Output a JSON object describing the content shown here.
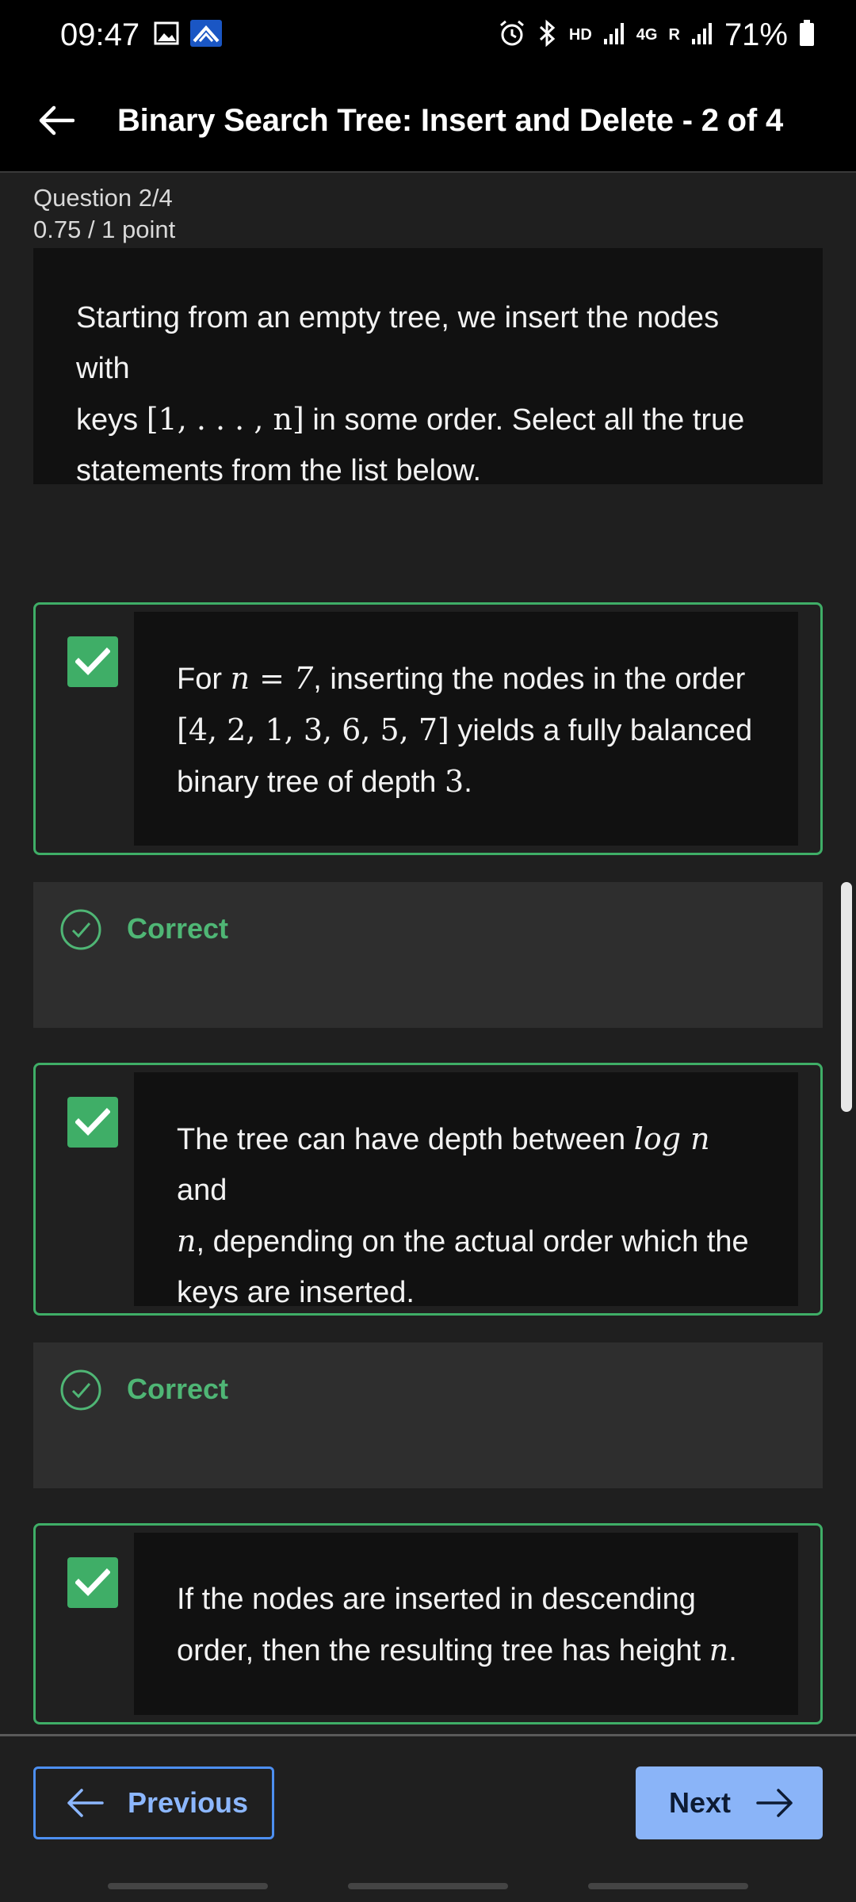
{
  "status_bar": {
    "time": "09:47",
    "network_label": "HD",
    "network_4g_label": "4G",
    "roaming_label": "R",
    "battery": "71%"
  },
  "header": {
    "title": "Binary Search Tree: Insert and Delete - 2 of 4"
  },
  "question": {
    "number": "Question 2/4",
    "score": "0.75 / 1 point",
    "prompt_a": "Starting from an empty tree, we insert the nodes with",
    "prompt_b": "keys",
    "prompt_keys": "[1, . . . , n]",
    "prompt_c": " in some order. Select all the true",
    "prompt_d": "statements from the list below."
  },
  "options": [
    {
      "checked": true,
      "t1": "For ",
      "m1": "n = 7",
      "t2": ", inserting the nodes in the order",
      "m2": "[4, 2, 1, 3, 6, 5, 7]",
      "t3": " yields a fully balanced",
      "t4": "binary tree of depth ",
      "m3": "3",
      "t5": ".",
      "feedback": "Correct"
    },
    {
      "checked": true,
      "t1": "The tree can have depth between ",
      "m1": "log n",
      "t2": " and",
      "m2": "n",
      "t3": ", depending on the actual order which the",
      "t4": "keys are inserted.",
      "feedback": "Correct"
    },
    {
      "checked": true,
      "t1": "If the nodes are inserted in descending",
      "t2": "order, then the resulting tree has height ",
      "m1": "n",
      "t3": "."
    }
  ],
  "navigation": {
    "previous_label": "Previous",
    "next_label": "Next"
  },
  "colors": {
    "correct_green": "#3fae67",
    "link_blue": "#8ab4f8"
  }
}
